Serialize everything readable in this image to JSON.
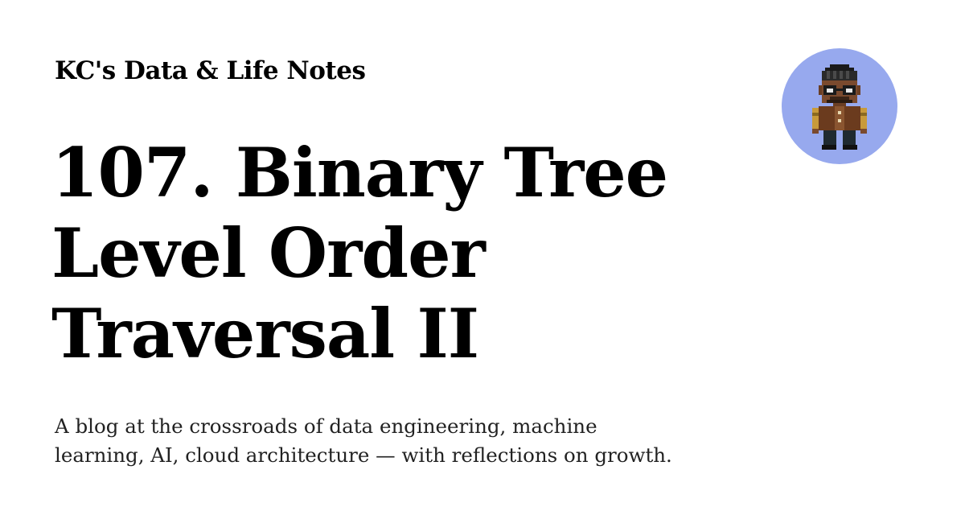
{
  "site": {
    "title": "KC's Data & Life Notes"
  },
  "post": {
    "title_lines": [
      "107. Binary Tree",
      "Level Order",
      "Traversal II"
    ]
  },
  "description": {
    "line1": "A blog at the crossroads of data engineering, machine",
    "line2": "learning, AI, cloud architecture — with reflections on growth."
  },
  "avatar": {
    "icon": "pixel-art-character-icon",
    "background_color": "#97a9ee"
  }
}
